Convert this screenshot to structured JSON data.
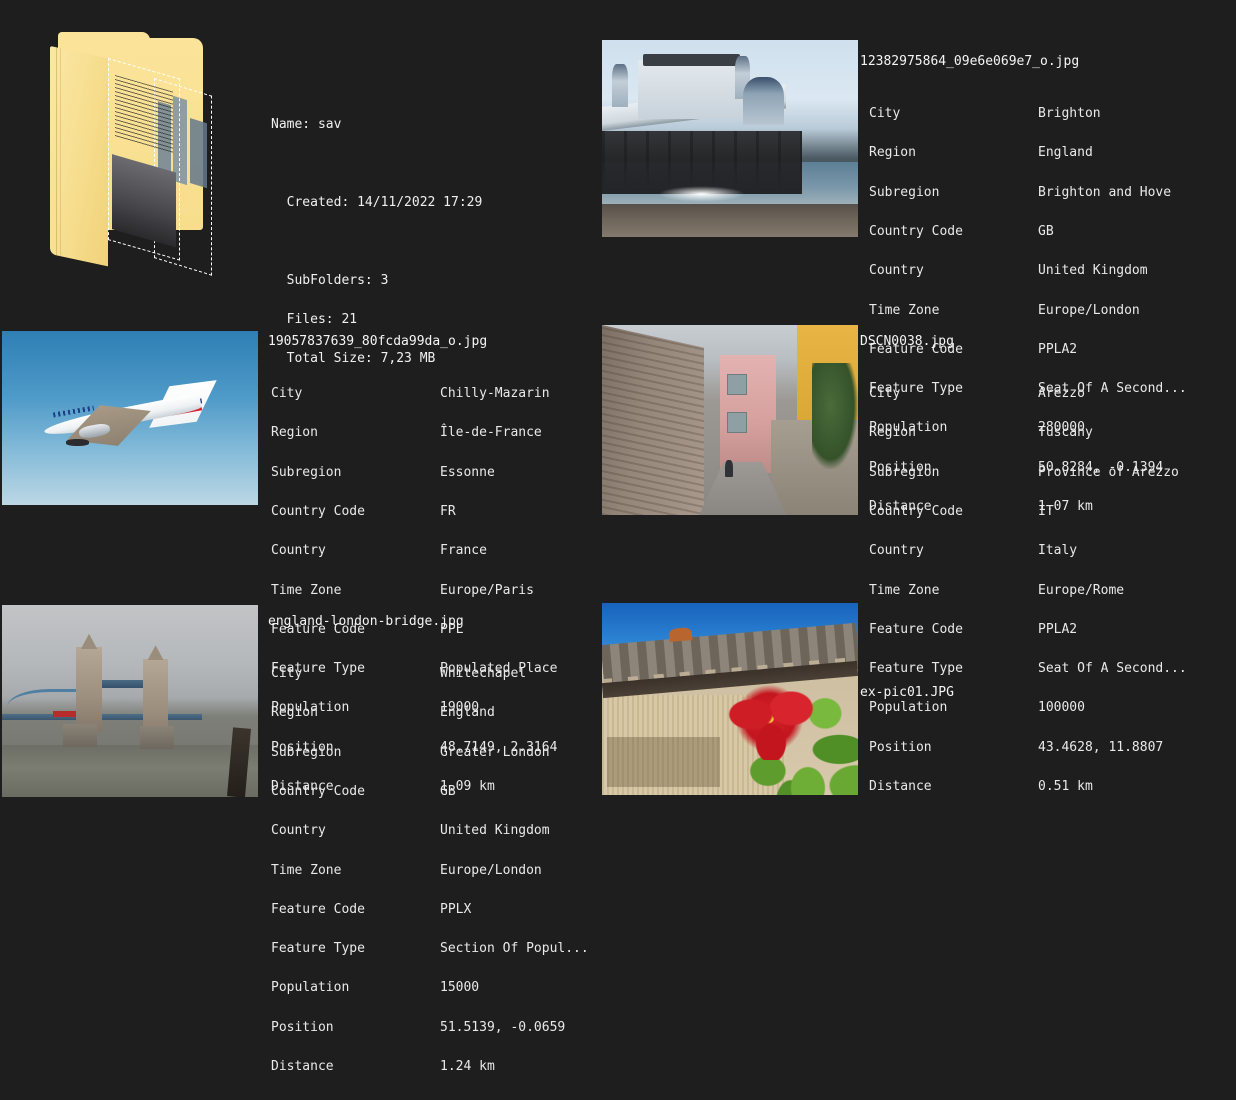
{
  "app": {
    "background_color": "#1e1e1e",
    "text_color": "#f0f0f0"
  },
  "folder": {
    "icon_name": "folder-with-photos-icon",
    "name_line": "Name: sav",
    "created_line": "  Created: 14/11/2022 17:29",
    "subfolders_line": "  SubFolders: 3",
    "files_line": "  Files: 21",
    "total_size_line": "  Total Size: 7,23 MB",
    "name_label": "Name:",
    "name_value": "sav",
    "created_label": "Created:",
    "created_value": "14/11/2022 17:29",
    "subfolders_label": "SubFolders:",
    "subfolders_value": "3",
    "files_label": "Files:",
    "files_value": "21",
    "total_size_label": "Total Size:",
    "total_size_value": "7,23 MB"
  },
  "field_labels": {
    "city": "City",
    "region": "Region",
    "subregion": "Subregion",
    "country_code": "Country Code",
    "country": "Country",
    "time_zone": "Time Zone",
    "feature_code": "Feature Code",
    "feature_type": "Feature Type",
    "population": "Population",
    "position": "Position",
    "distance": "Distance"
  },
  "items": [
    {
      "filename": "12382975864_09e6e069e7_o.jpg",
      "photo_name": "brighton-pier-photo",
      "city": "Brighton",
      "region": "England",
      "subregion": "Brighton and Hove",
      "country_code": "GB",
      "country": "United Kingdom",
      "time_zone": "Europe/London",
      "feature_code": "PPLA2",
      "feature_type": "Seat Of A Second...",
      "population": "280000",
      "position": "50.8284, -0.1394",
      "distance": "1.07 km"
    },
    {
      "filename": "19057837639_80fcda99da_o.jpg",
      "photo_name": "air-france-plane-photo",
      "city": "Chilly-Mazarin",
      "region": "Île-de-France",
      "subregion": "Essonne",
      "country_code": "FR",
      "country": "France",
      "time_zone": "Europe/Paris",
      "feature_code": "PPL",
      "feature_type": "Populated Place",
      "population": "19000",
      "position": "48.7149, 2.3164",
      "distance": "1.09 km"
    },
    {
      "filename": "DSCN0038.jpg",
      "photo_name": "arezzo-alley-photo",
      "city": "Arezzo",
      "region": "Tuscany",
      "subregion": "Province of Arezzo",
      "country_code": "IT",
      "country": "Italy",
      "time_zone": "Europe/Rome",
      "feature_code": "PPLA2",
      "feature_type": "Seat Of A Second...",
      "population": "100000",
      "position": "43.4628, 11.8807",
      "distance": "0.51 km"
    },
    {
      "filename": "england-london-bridge.jpg",
      "photo_name": "tower-bridge-photo",
      "city": "Whitechapel",
      "region": "England",
      "subregion": "Greater London",
      "country_code": "GB",
      "country": "United Kingdom",
      "time_zone": "Europe/London",
      "feature_code": "PPLX",
      "feature_type": "Section Of Popul...",
      "population": "15000",
      "position": "51.5139, -0.0659",
      "distance": "1.24 km"
    },
    {
      "filename": "ex-pic01.JPG",
      "photo_name": "hibiscus-roof-photo",
      "city": "",
      "region": "",
      "subregion": "",
      "country_code": "",
      "country": "",
      "time_zone": "",
      "feature_code": "",
      "feature_type": "",
      "population": "",
      "position": "",
      "distance": ""
    }
  ]
}
